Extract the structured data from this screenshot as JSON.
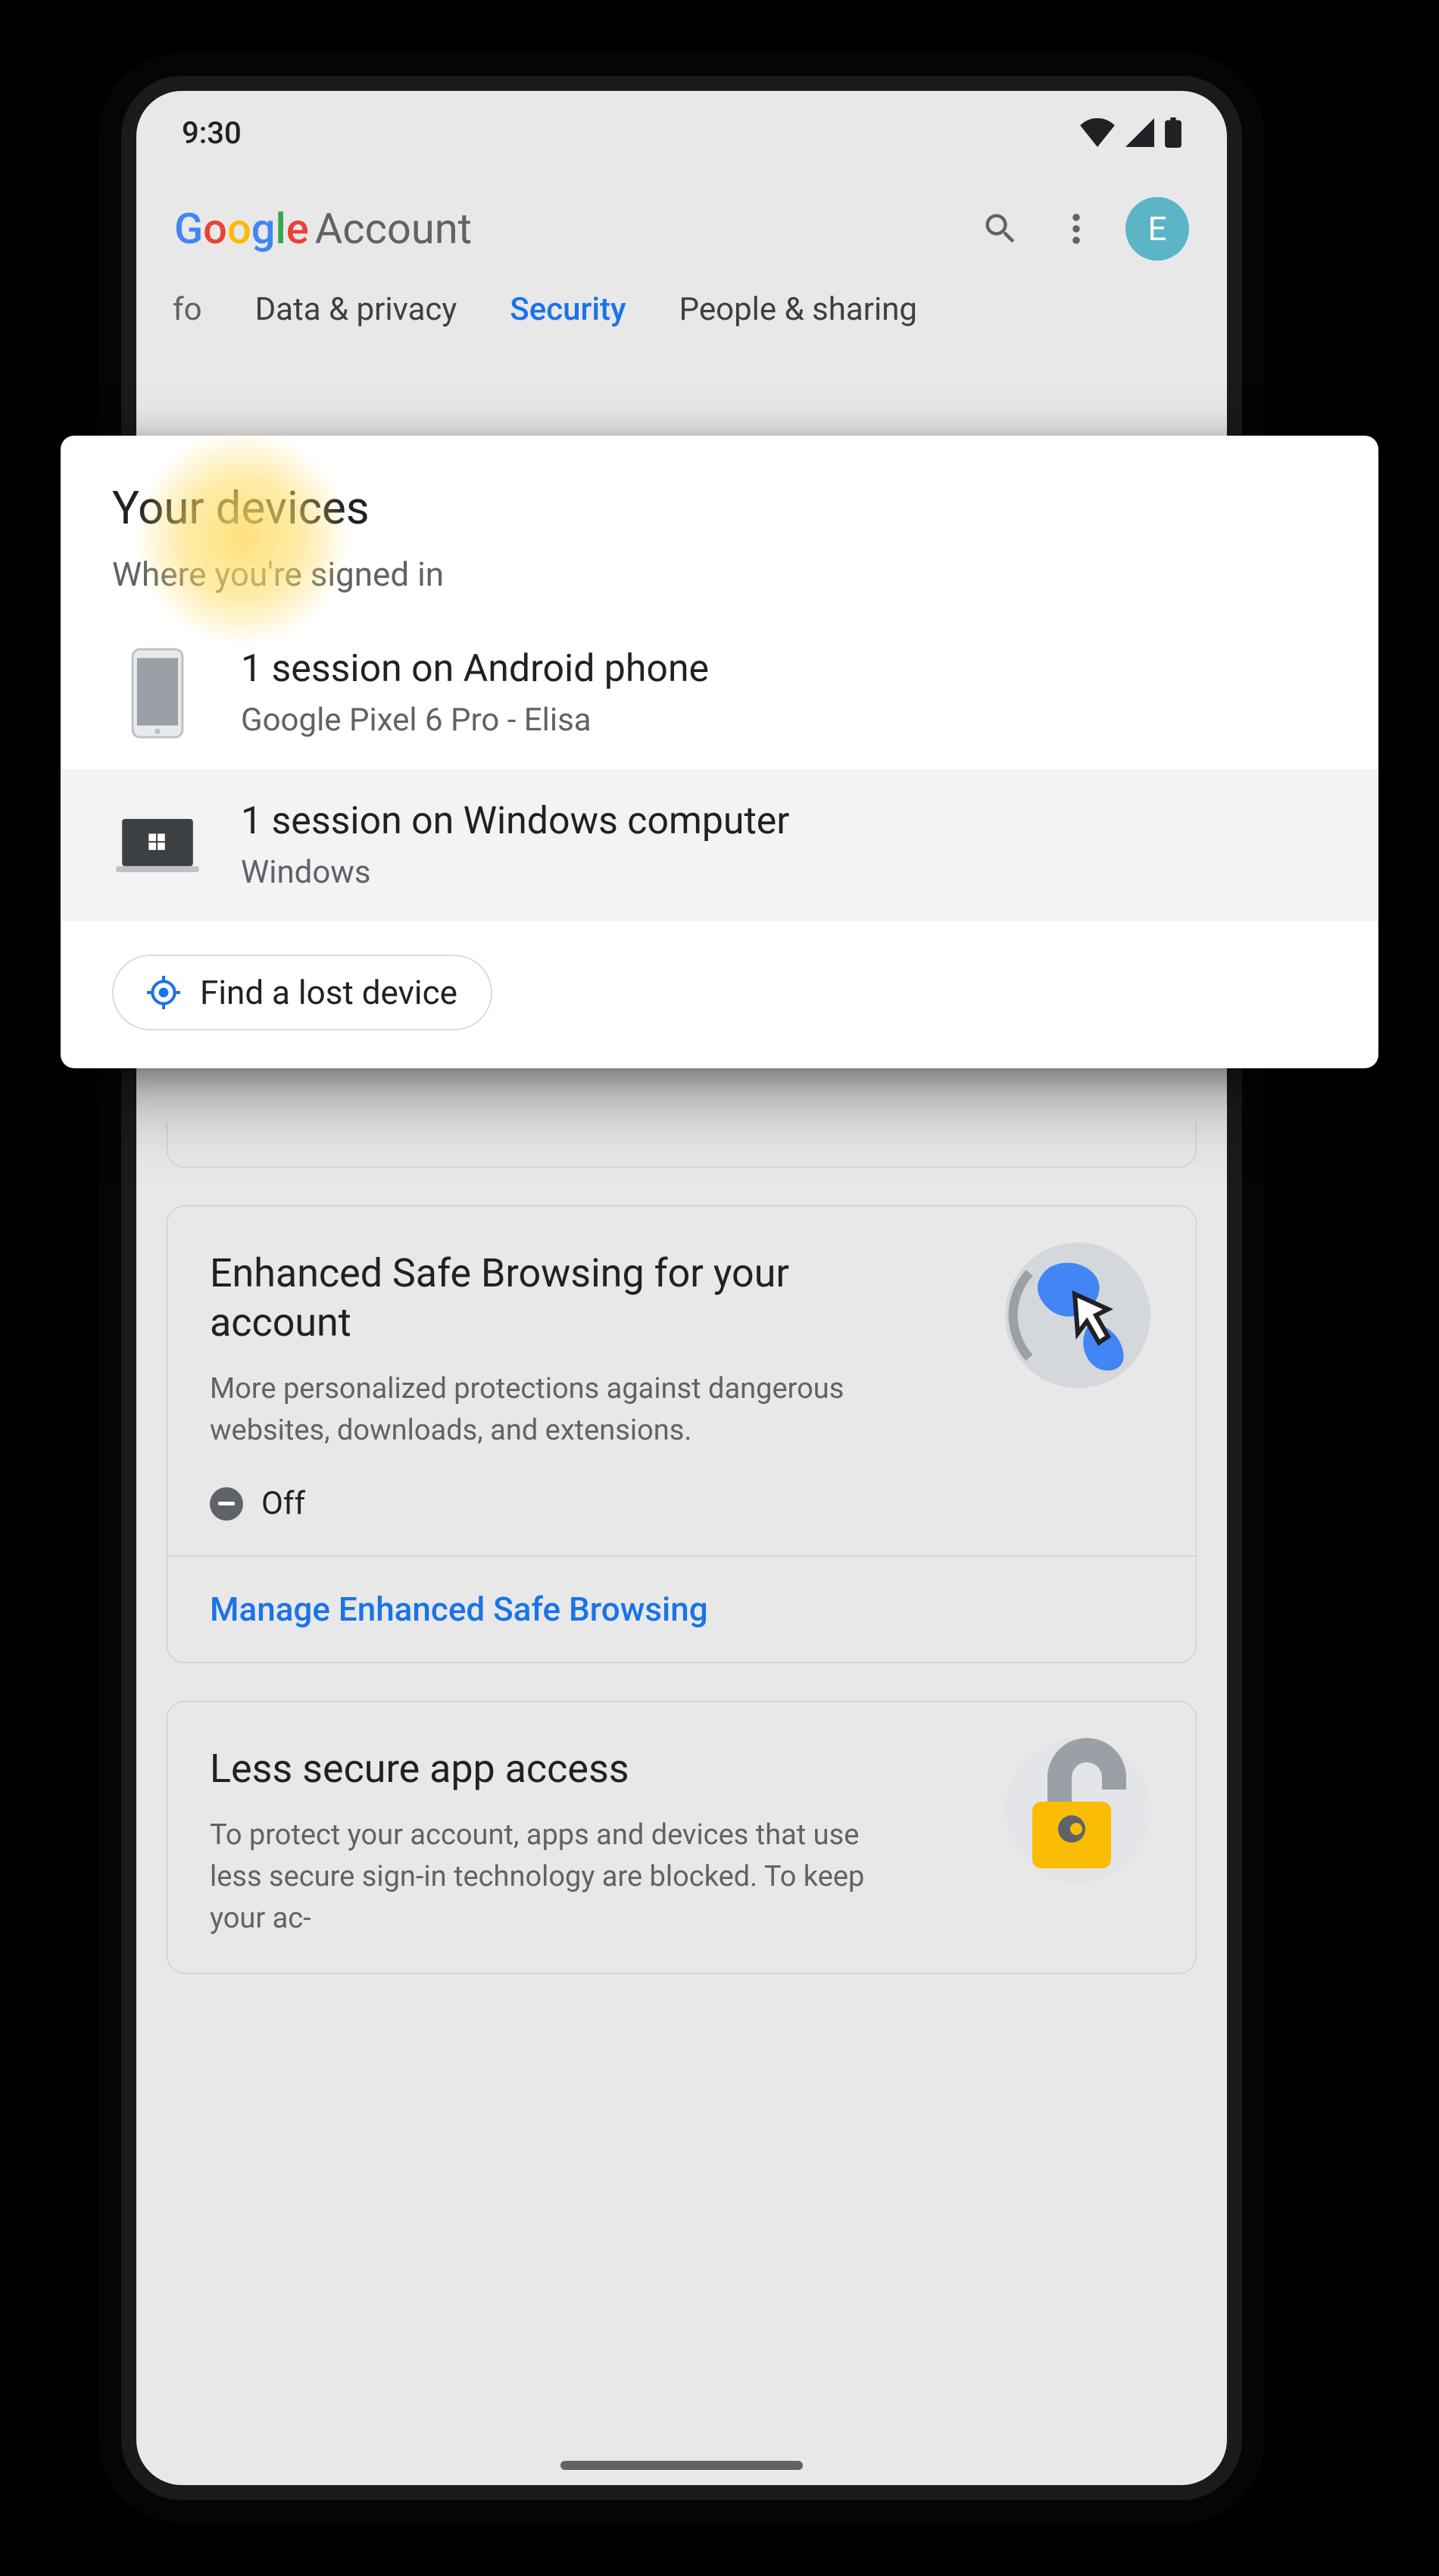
{
  "status": {
    "time": "9:30"
  },
  "appbar": {
    "brand_account_label": "Account",
    "avatar_initial": "E"
  },
  "tabs": {
    "partial_left": "fo",
    "data_privacy": "Data & privacy",
    "security": "Security",
    "people_sharing": "People & sharing"
  },
  "popup": {
    "title": "Your devices",
    "subtitle": "Where you're signed in",
    "devices": [
      {
        "title": "1 session on Android phone",
        "sub": "Google Pixel 6 Pro - Elisa"
      },
      {
        "title": "1 session on Windows computer",
        "sub": "Windows"
      }
    ],
    "find_lost_label": "Find a lost device"
  },
  "cards": {
    "esb": {
      "title": "Enhanced Safe Browsing for your account",
      "desc": "More personalized protections against dangerous websites, downloads, and extensions.",
      "status": "Off",
      "link": "Manage Enhanced Safe Browsing"
    },
    "lsa": {
      "title": "Less secure app access",
      "desc": "To protect your account, apps and devices that use less secure sign-in technology are blocked. To keep your ac-"
    }
  }
}
